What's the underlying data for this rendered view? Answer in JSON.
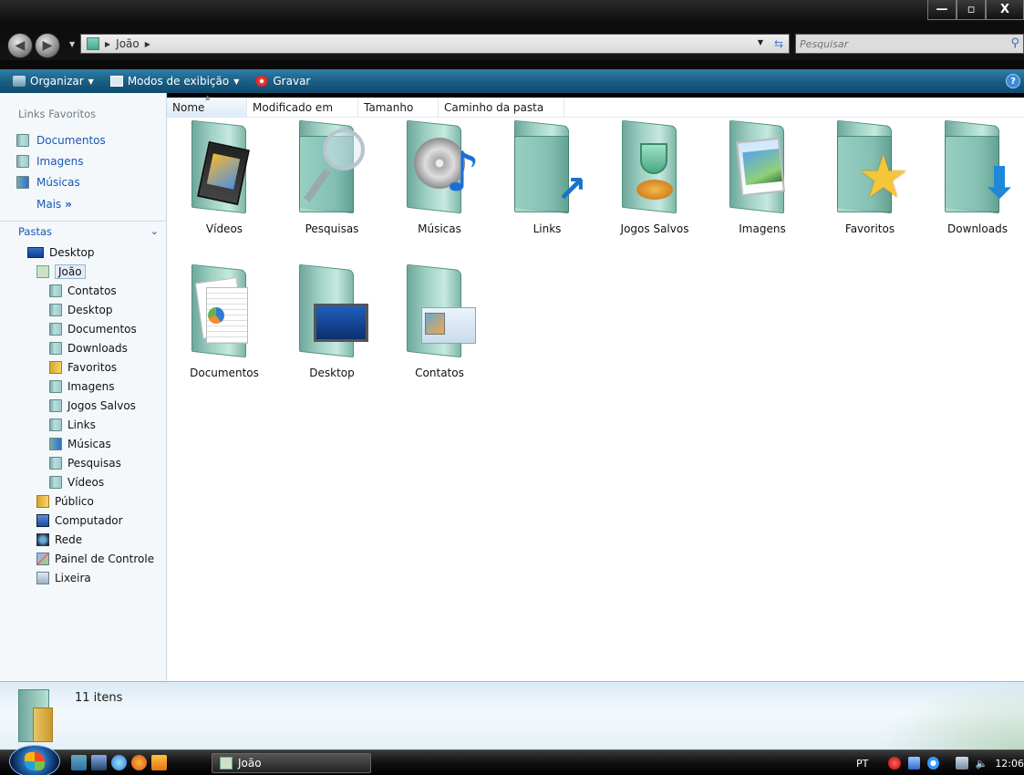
{
  "window": {
    "breadcrumb": [
      "João"
    ],
    "search_placeholder": "Pesquisar",
    "controls": {
      "minimize": "—",
      "maximize": "▫",
      "close": "X"
    }
  },
  "toolbar": {
    "organize": "Organizar",
    "views": "Modos de exibição",
    "burn": "Gravar"
  },
  "sidebar": {
    "favorites_title": "Links Favoritos",
    "favorites": [
      {
        "label": "Documentos",
        "icon": "documents-icon"
      },
      {
        "label": "Imagens",
        "icon": "pictures-icon"
      },
      {
        "label": "Músicas",
        "icon": "music-icon"
      }
    ],
    "more": "Mais",
    "more_glyph": "»",
    "folders_title": "Pastas",
    "tree": [
      {
        "label": "Desktop",
        "indent": 0,
        "icon": "desktop-icon"
      },
      {
        "label": "João",
        "indent": 1,
        "icon": "user-folder-icon",
        "selected": true
      },
      {
        "label": "Contatos",
        "indent": 2,
        "icon": "contacts-icon"
      },
      {
        "label": "Desktop",
        "indent": 2,
        "icon": "desktop-folder-icon"
      },
      {
        "label": "Documentos",
        "indent": 2,
        "icon": "documents-icon"
      },
      {
        "label": "Downloads",
        "indent": 2,
        "icon": "downloads-icon"
      },
      {
        "label": "Favoritos",
        "indent": 2,
        "icon": "favorites-icon"
      },
      {
        "label": "Imagens",
        "indent": 2,
        "icon": "pictures-icon"
      },
      {
        "label": "Jogos Salvos",
        "indent": 2,
        "icon": "saved-games-icon"
      },
      {
        "label": "Links",
        "indent": 2,
        "icon": "links-icon"
      },
      {
        "label": "Músicas",
        "indent": 2,
        "icon": "music-icon"
      },
      {
        "label": "Pesquisas",
        "indent": 2,
        "icon": "searches-icon"
      },
      {
        "label": "Vídeos",
        "indent": 2,
        "icon": "videos-icon"
      },
      {
        "label": "Público",
        "indent": 1,
        "icon": "public-folder-icon"
      },
      {
        "label": "Computador",
        "indent": 1,
        "icon": "computer-icon"
      },
      {
        "label": "Rede",
        "indent": 1,
        "icon": "network-icon"
      },
      {
        "label": "Painel de Controle",
        "indent": 1,
        "icon": "control-panel-icon"
      },
      {
        "label": "Lixeira",
        "indent": 1,
        "icon": "recycle-bin-icon"
      }
    ]
  },
  "columns": [
    "Nome",
    "Modificado em",
    "Tamanho",
    "Caminho da pasta"
  ],
  "items": [
    {
      "label": "Vídeos",
      "icon": "videos-folder-icon"
    },
    {
      "label": "Pesquisas",
      "icon": "searches-folder-icon"
    },
    {
      "label": "Músicas",
      "icon": "music-folder-icon"
    },
    {
      "label": "Links",
      "icon": "links-folder-icon"
    },
    {
      "label": "Jogos Salvos",
      "icon": "saved-games-folder-icon"
    },
    {
      "label": "Imagens",
      "icon": "pictures-folder-icon"
    },
    {
      "label": "Favoritos",
      "icon": "favorites-folder-icon"
    },
    {
      "label": "Downloads",
      "icon": "downloads-folder-icon"
    },
    {
      "label": "Documentos",
      "icon": "documents-folder-icon"
    },
    {
      "label": "Desktop",
      "icon": "desktop-folder-icon"
    },
    {
      "label": "Contatos",
      "icon": "contacts-folder-icon"
    }
  ],
  "status": {
    "count": "11 itens"
  },
  "taskbar": {
    "task_label": "João",
    "language": "PT",
    "clock": "12:06"
  }
}
